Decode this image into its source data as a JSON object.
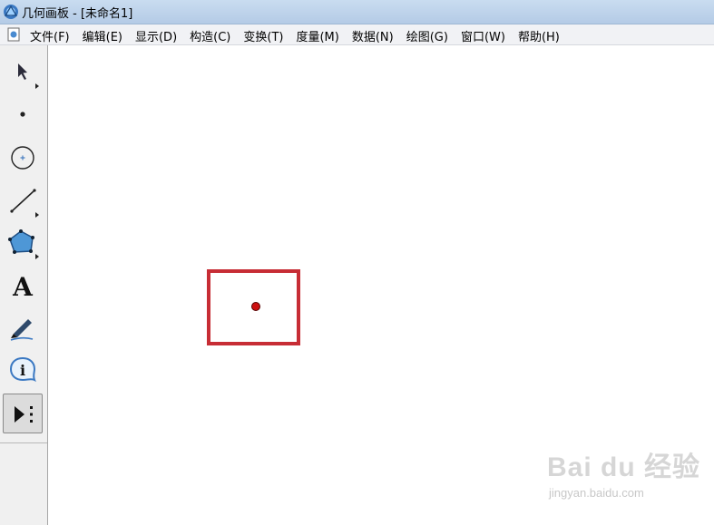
{
  "window": {
    "title": "几何画板 - [未命名1]"
  },
  "menu": {
    "items": [
      {
        "label": "文件(F)"
      },
      {
        "label": "编辑(E)"
      },
      {
        "label": "显示(D)"
      },
      {
        "label": "构造(C)"
      },
      {
        "label": "变换(T)"
      },
      {
        "label": "度量(M)"
      },
      {
        "label": "数据(N)"
      },
      {
        "label": "绘图(G)"
      },
      {
        "label": "窗口(W)"
      },
      {
        "label": "帮助(H)"
      }
    ]
  },
  "toolbar": {
    "tools": [
      {
        "name": "arrow-tool",
        "icon": "arrow-icon"
      },
      {
        "name": "point-tool",
        "icon": "point-icon"
      },
      {
        "name": "compass-tool",
        "icon": "compass-icon"
      },
      {
        "name": "straightedge-tool",
        "icon": "segment-icon"
      },
      {
        "name": "polygon-tool",
        "icon": "polygon-icon"
      },
      {
        "name": "text-tool",
        "icon": "text-icon",
        "glyph": "A"
      },
      {
        "name": "marker-tool",
        "icon": "marker-icon"
      },
      {
        "name": "information-tool",
        "icon": "info-icon",
        "glyph": "i"
      },
      {
        "name": "custom-tool",
        "icon": "custom-tool-icon",
        "selected": true
      }
    ]
  },
  "watermark": {
    "big": "Bai du 经验",
    "small": "jingyan.baidu.com"
  },
  "colors": {
    "highlight": "#c72d35",
    "point": "#cc1111"
  }
}
